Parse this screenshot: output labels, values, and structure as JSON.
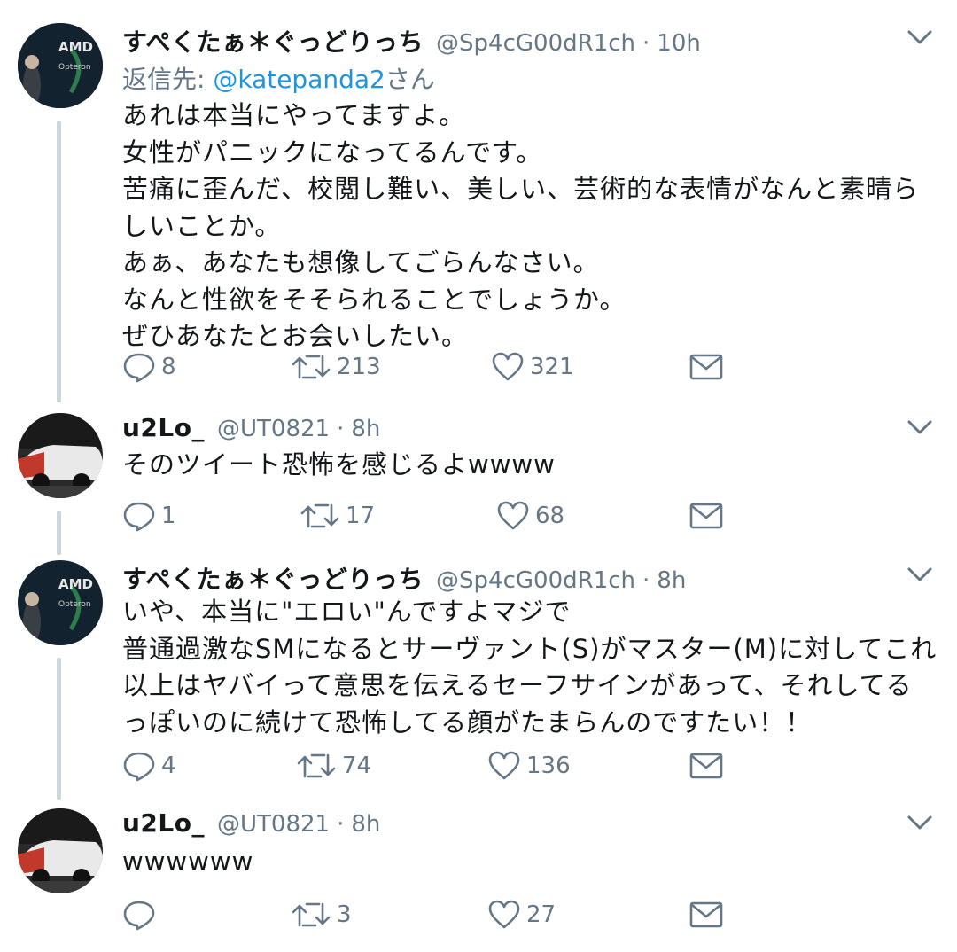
{
  "tweets": [
    {
      "name": "すぺくたぁ＊ぐっどりっち",
      "handle": "@Sp4cG00dR1ch",
      "time": "10h",
      "reply_prefix": "返信先: ",
      "reply_mention": "@katepanda2",
      "reply_suffix": "さん",
      "lines": [
        "あれは本当にやってますよ。",
        "女性がパニックになってるんです。",
        "苦痛に歪んだ、校閲し難い、美しい、芸術的な表情がなんと素晴ら",
        "しいことか。",
        "あぁ、あなたも想像してごらんなさい。",
        "なんと性欲をそそられることでしょうか。",
        "ぜひあなたとお会いしたい。"
      ],
      "replies": "8",
      "retweets": "213",
      "likes": "321",
      "avatar_text": "AMD",
      "avatar_sub": "Opteron"
    },
    {
      "name": "u2Lo_",
      "handle": "@UT0821",
      "time": "8h",
      "lines": [
        "そのツイート恐怖を感じるよwwww"
      ],
      "replies": "1",
      "retweets": "17",
      "likes": "68"
    },
    {
      "name": "すぺくたぁ＊ぐっどりっち",
      "handle": "@Sp4cG00dR1ch",
      "time": "8h",
      "lines": [
        "いや、本当に\"エロい\"んですよマジで",
        "普通過激なSMになるとサーヴァント(S)がマスター(M)に対してこれ",
        "以上はヤバイって意思を伝えるセーフサインがあって、それしてる",
        "っぽいのに続けて恐怖してる顔がたまらんのですたい！！"
      ],
      "replies": "4",
      "retweets": "74",
      "likes": "136",
      "avatar_text": "AMD",
      "avatar_sub": "Opteron"
    },
    {
      "name": "u2Lo_",
      "handle": "@UT0821",
      "time": "8h",
      "lines": [
        "wwwwww"
      ],
      "replies": "",
      "retweets": "3",
      "likes": "27"
    }
  ],
  "separator": "·",
  "icons": {
    "reply": "reply-icon",
    "retweet": "retweet-icon",
    "like": "heart-icon",
    "dm": "envelope-icon",
    "menu": "chevron-down-icon"
  },
  "colors": {
    "text": "#14171a",
    "secondary": "#657786",
    "mention": "#1b95e0",
    "thread_line": "#ccd6dd"
  }
}
